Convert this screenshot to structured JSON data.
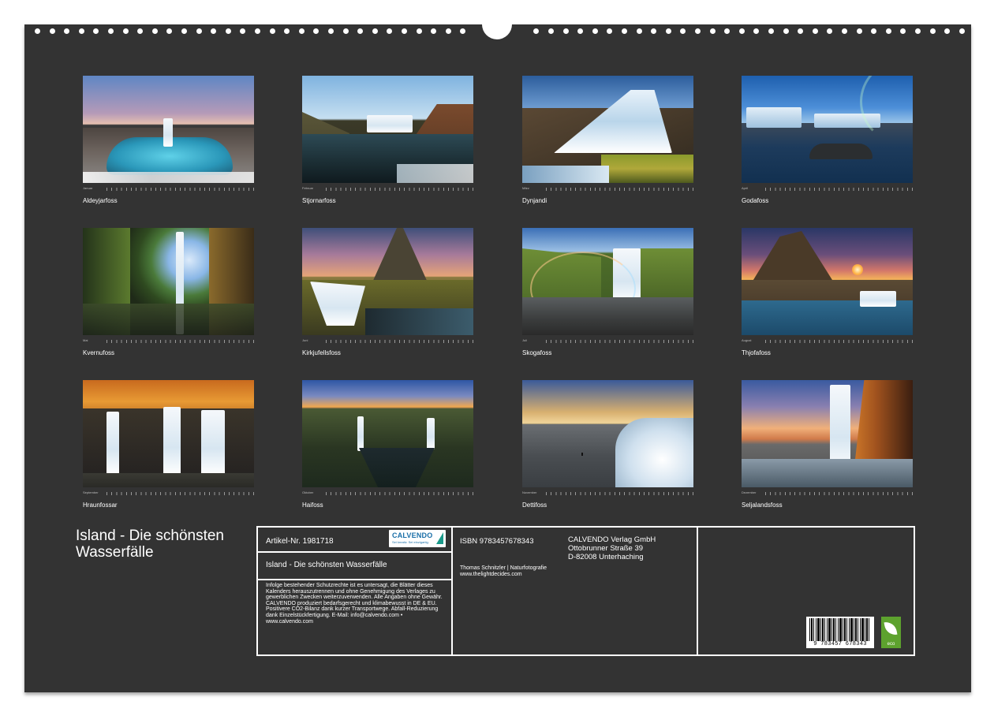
{
  "calendar": {
    "title": "Island - Die schönsten Wasserfälle",
    "months": [
      {
        "caption": "Aldeyjarfoss",
        "month_label": "Januar"
      },
      {
        "caption": "Stjornarfoss",
        "month_label": "Februar"
      },
      {
        "caption": "Dynjandi",
        "month_label": "März"
      },
      {
        "caption": "Godafoss",
        "month_label": "April"
      },
      {
        "caption": "Kvernufoss",
        "month_label": "Mai"
      },
      {
        "caption": "Kirkjufellsfoss",
        "month_label": "Juni"
      },
      {
        "caption": "Skogafoss",
        "month_label": "Juli"
      },
      {
        "caption": "Thjofafoss",
        "month_label": "August"
      },
      {
        "caption": "Hraunfossar",
        "month_label": "September"
      },
      {
        "caption": "Haifoss",
        "month_label": "Oktober"
      },
      {
        "caption": "Dettifoss",
        "month_label": "November"
      },
      {
        "caption": "Seljalandsfoss",
        "month_label": "Dezember"
      }
    ]
  },
  "info": {
    "artikel": "Artikel-Nr. 1981718",
    "logo_brand": "CALVENDO",
    "logo_tag": "Sei kreativ. Sei einzigartig.",
    "subtitle": "Island - Die schönsten Wasserfälle",
    "legal": "Infolge bestehender Schutzrechte ist es untersagt, die Blätter dieses Kalenders herauszutrennen und ohne Genehmigung des Verlages zu gewerblichen Zwecken weiterzuverwenden. Alle Angaben ohne Gewähr. CALVENDO produziert bedarfsgerecht und klimabewusst in DE & EU. Positivere CO2-Bilanz dank kurzer Transportwege. Abfall-Reduzierung dank Einzelstückfertigung. E-Mail: info@calvendo.com • www.calvendo.com",
    "isbn": "ISBN 9783457678343",
    "publisher_name": "CALVENDO Verlag GmbH",
    "publisher_street": "Ottobrunner Straße 39",
    "publisher_city": "D-82008 Unterhaching",
    "author_line": "Thomas Schnitzler | Naturfotografie",
    "author_url": "www.thelightdecides.com",
    "barcode_number": "9 783457 678343",
    "eco_label": "eco"
  },
  "colors": {
    "background": "#333333",
    "text": "#ffffff",
    "eco_green": "#5da22e",
    "calvendo_blue": "#1a6fa8"
  }
}
